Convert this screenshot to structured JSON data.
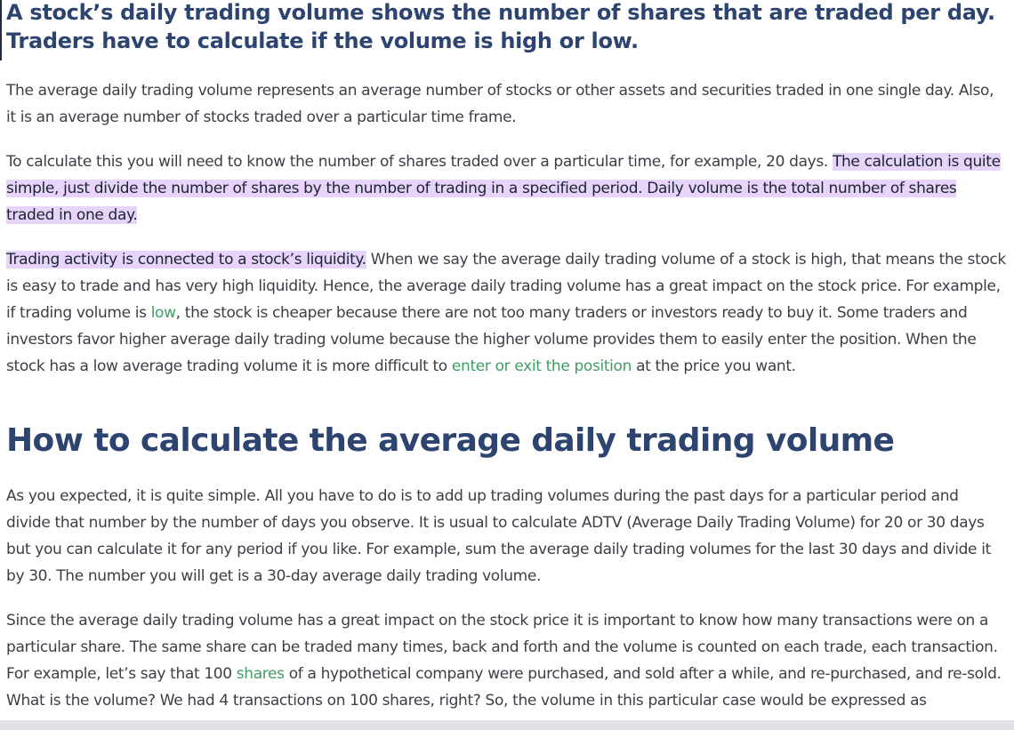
{
  "article": {
    "lead_heading": "A stock’s daily trading volume shows the number of shares that are traded per day. Traders have to calculate if the volume is high or low.",
    "p1": "The average daily trading volume represents an average number of stocks or other assets and securities traded in one single day. Also, it is an average number of stocks traded over a particular time frame.",
    "p2_a": "To calculate this you will need to know the number of shares traded over a particular time, for example, 20 days. ",
    "p2_highlight": "The calculation is quite simple, just divide the number of shares by the number of trading in a specified period. Daily volume is the total number of shares traded in one day. ",
    "p3_highlight": "Trading activity is connected to a stock’s liquidity.",
    "p3_a": " When we say the average daily trading volume of a stock is high, that means the stock is easy to trade and has very high liquidity. Hence, the average daily trading volume has a great impact on the stock price. For example, if trading volume is ",
    "p3_link_low": "low",
    "p3_b": ", the stock is cheaper because there are not too many traders or investors ready to buy it. Some traders and investors favor higher average daily trading volume because the higher volume provides them to easily enter the position. When the stock has a low average trading volume it is more difficult to ",
    "p3_link_position": "enter or exit the position",
    "p3_c": " at the price you want.",
    "section_heading": "How to calculate the average daily trading volume",
    "p4": "As you expected, it is quite simple. All you have to do is to add up trading volumes during the past days for a particular period and divide that number by the number of days you observe. It is usual to calculate ADTV (Average Daily Trading Volume) for 20 or 30 days but you can calculate it for any period if you like. For example, sum the average daily trading volumes for the last 30 days and divide it by 30. The number you will get is a 30-day average daily trading volume.",
    "p5_a": "Since the average daily trading volume has a great impact on the stock price it is important to know how many transactions were on a particular share. The same share can be traded many times, back and forth and the volume is counted on each trade, each transaction. For example, let’s say that 100 ",
    "p5_link_shares": "shares",
    "p5_b": " of a hypothetical company were purchased, and sold after a while, and re-purchased, and re-sold. What is the volume? We had 4 transactions on 100 shares, right? So, the volume in this particular case would be expressed as"
  },
  "colors": {
    "heading": "#2e4470",
    "body_text": "#3b3f45",
    "highlight": "#e6d4fb",
    "link": "#3f9d63"
  }
}
